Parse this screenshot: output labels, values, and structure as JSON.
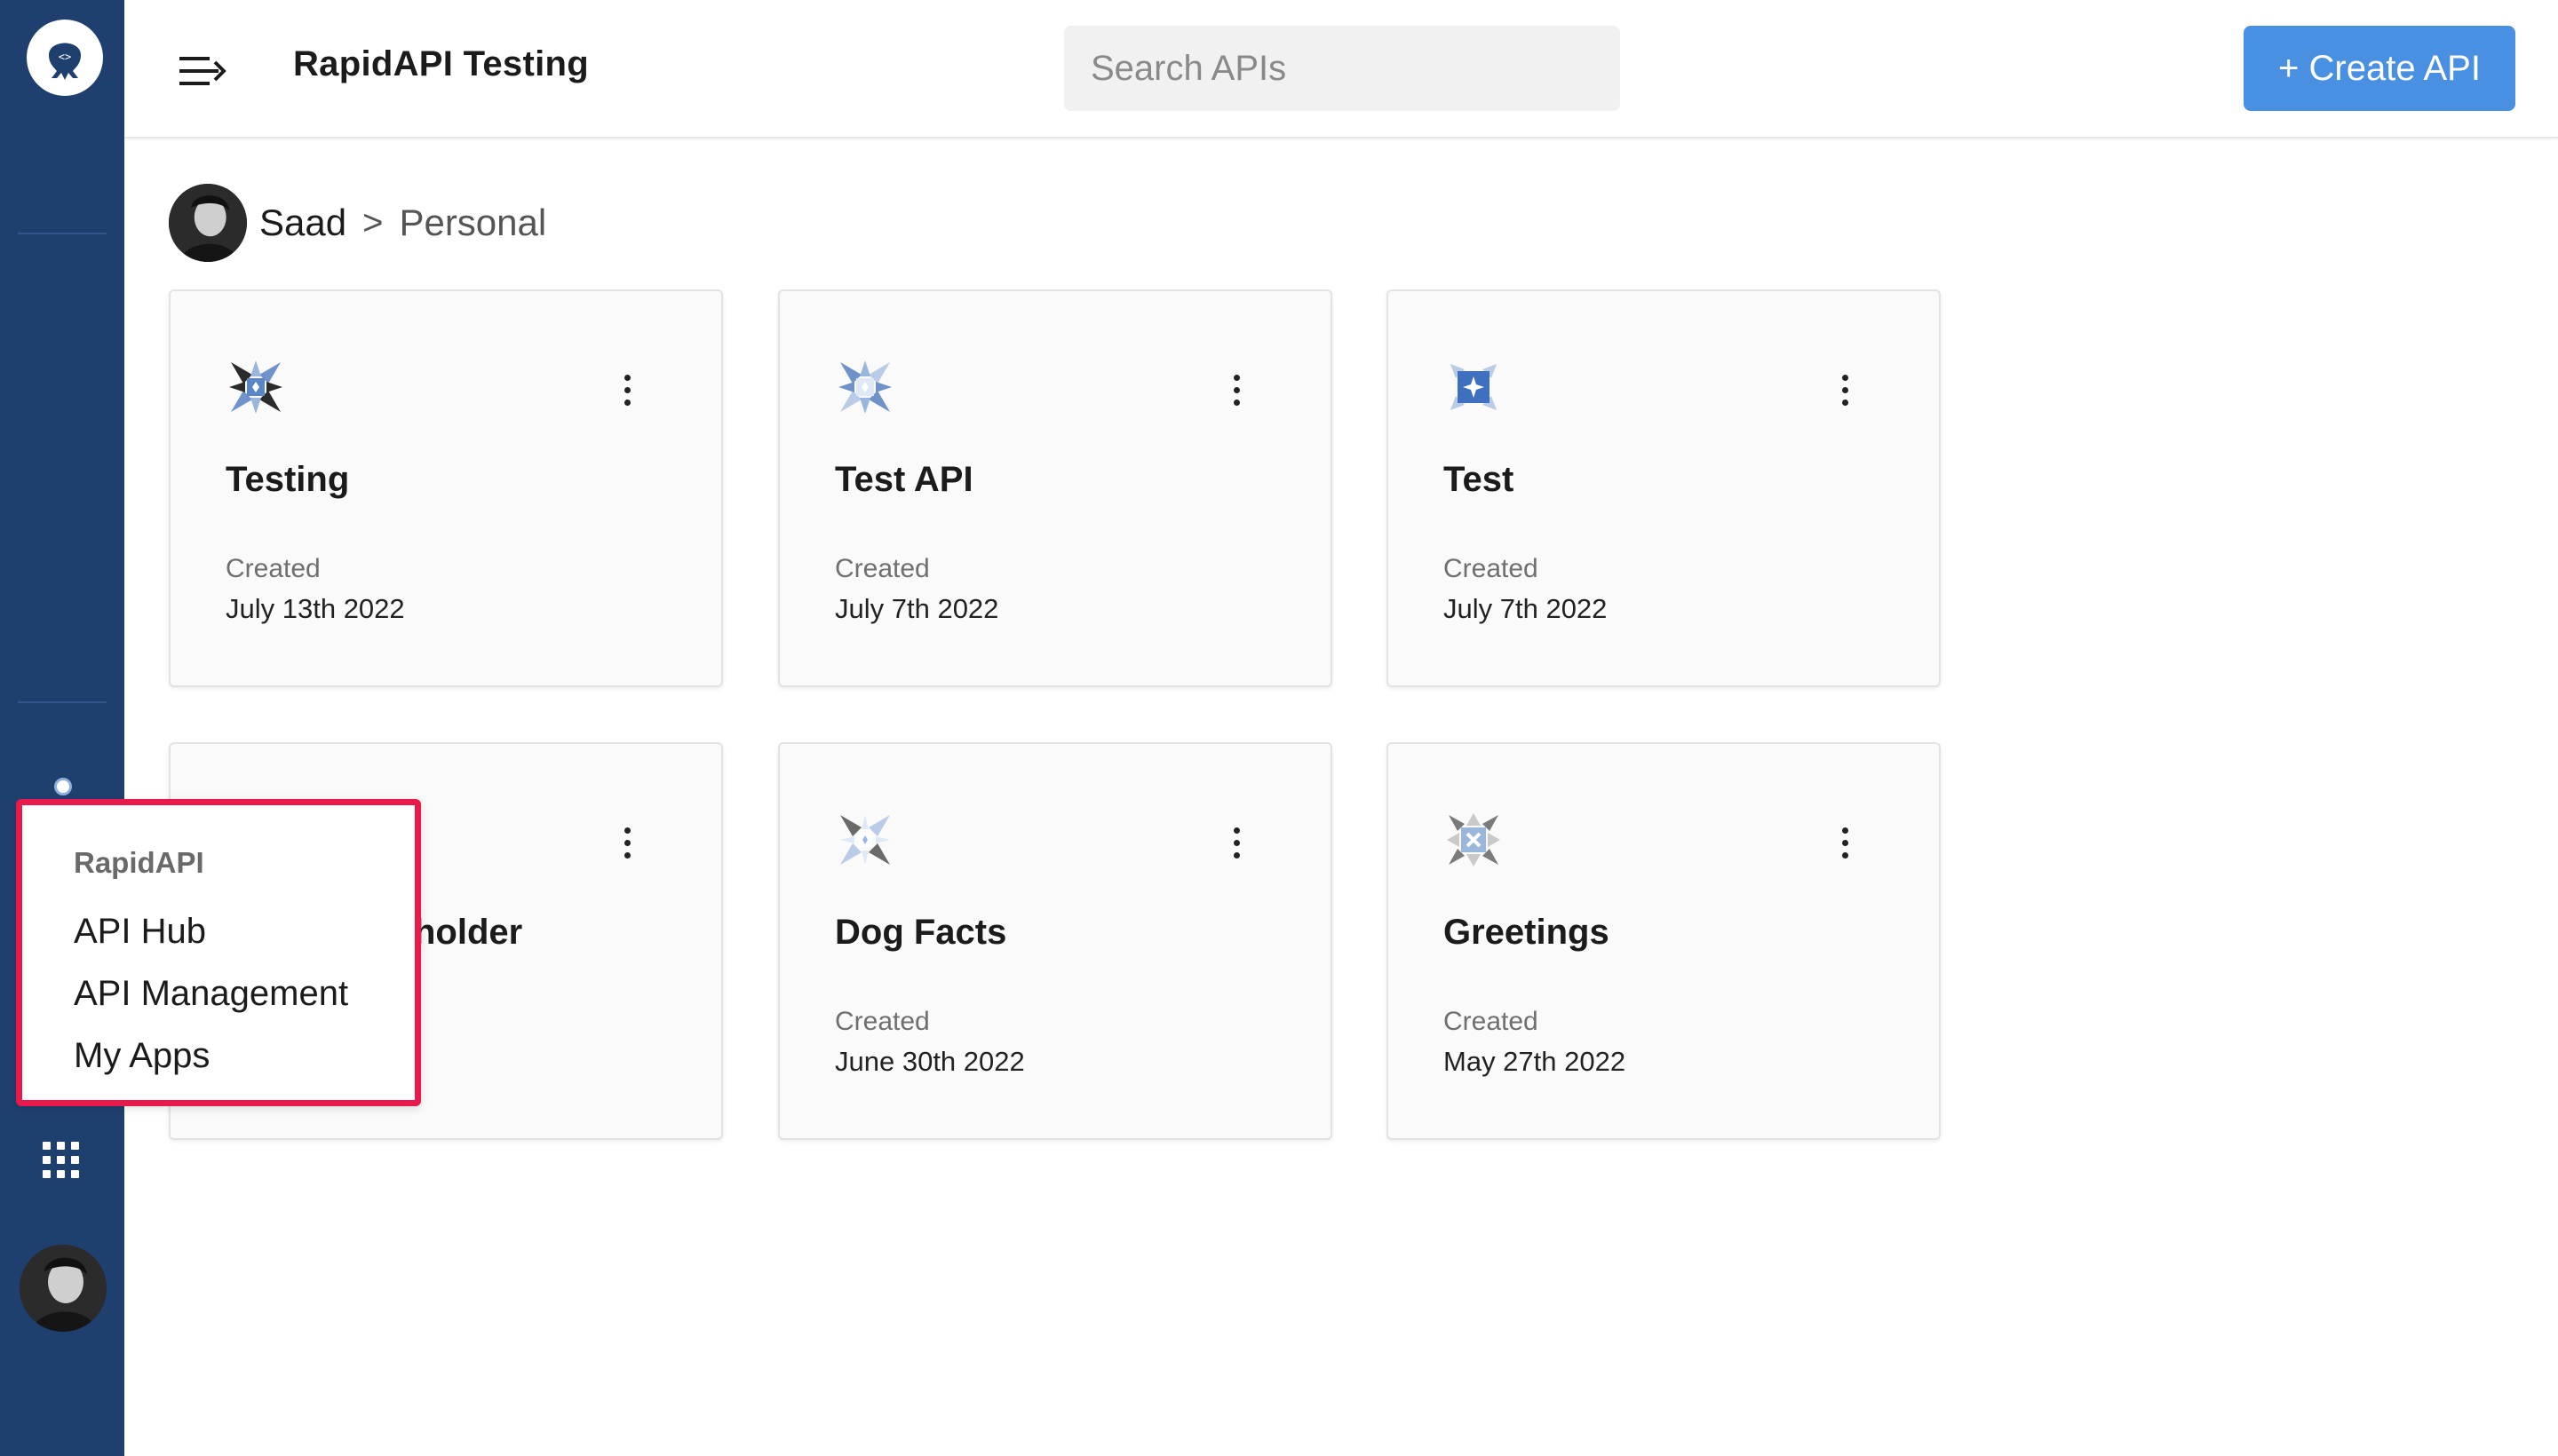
{
  "header": {
    "title": "RapidAPI Testing",
    "search_placeholder": "Search APIs",
    "create_label": "+ Create API"
  },
  "breadcrumb": {
    "user": "Saad",
    "separator": ">",
    "workspace": "Personal"
  },
  "cards": [
    {
      "name": "Testing",
      "created_label": "Created",
      "created_date": "July 13th 2022",
      "icon": "pinwheel-logo-icon"
    },
    {
      "name": "Test API",
      "created_label": "Created",
      "created_date": "July 7th 2022",
      "icon": "pinwheel-logo-icon"
    },
    {
      "name": "Test",
      "created_label": "Created",
      "created_date": "July 7th 2022",
      "icon": "pinwheel-logo-icon"
    },
    {
      "name": "holder",
      "created_label": "",
      "created_date": "",
      "icon": "pinwheel-logo-icon"
    },
    {
      "name": "Dog Facts",
      "created_label": "Created",
      "created_date": "June 30th 2022",
      "icon": "pinwheel-logo-icon"
    },
    {
      "name": "Greetings",
      "created_label": "Created",
      "created_date": "May 27th 2022",
      "icon": "pinwheel-logo-icon"
    }
  ],
  "popover": {
    "title": "RapidAPI",
    "items": [
      "API Hub",
      "API Management",
      "My Apps"
    ]
  },
  "colors": {
    "rail": "#1f3f6f",
    "accent": "#4a90e2",
    "highlight_border": "#e8194b"
  },
  "icons": {
    "logo": "octopus-logo-icon",
    "menu": "menu-collapse-icon",
    "apps": "apps-grid-icon",
    "card_menu": "more-vertical-icon"
  }
}
